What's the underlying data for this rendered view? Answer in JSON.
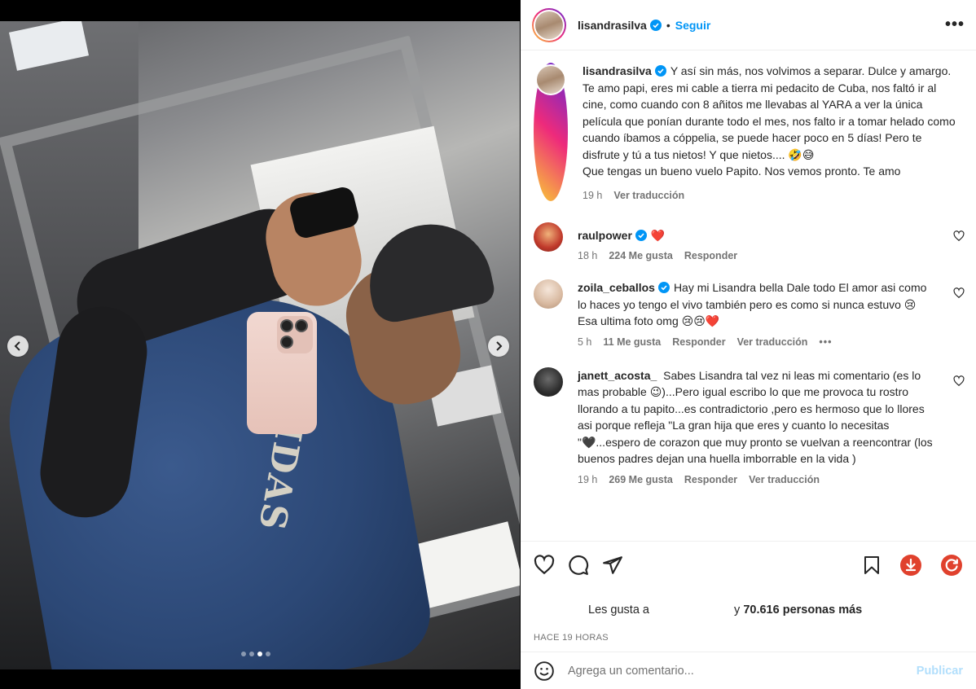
{
  "post": {
    "author": "lisandrasilva",
    "follow_label": "Seguir",
    "more_label": "•••",
    "caption": "Y así sin más, nos volvimos a separar. Dulce y amargo. Te amo papi, eres mi cable a tierra mi pedacito de Cuba, nos faltó ir al cine, como cuando con 8 añitos me llevabas al YARA a ver la única película que ponían durante todo el mes, nos falto ir a tomar helado como cuando íbamos a cóppelia, se puede hacer poco en 5 días! Pero te disfrute y tú a tus nietos! Y que nietos.... 🤣😅",
    "caption_line2": "Que tengas un bueno vuelo Papito. Nos vemos pronto. Te amo",
    "caption_time": "19 h",
    "see_translation": "Ver traducción",
    "carousel_dots": 4,
    "carousel_active": 2
  },
  "comments": [
    {
      "user": "raulpower",
      "verified": true,
      "text": "❤️",
      "time": "18 h",
      "likes": "224 Me gusta",
      "reply": "Responder",
      "translate": ""
    },
    {
      "user": "zoila_ceballos",
      "verified": true,
      "text": "Hay mi Lisandra bella Dale todo El amor asi como lo haces yo tengo el vivo también pero es como si nunca estuvo 😢 Esa ultima foto omg 😢😢❤️",
      "time": "5 h",
      "likes": "11 Me gusta",
      "reply": "Responder",
      "translate": "Ver traducción"
    },
    {
      "user": "janett_acosta_",
      "verified": false,
      "text": "Sabes Lisandra tal vez ni leas mi comentario (es lo mas probable 😉)...Pero igual escribo lo que me provoca tu rostro llorando a tu papito...es contradictorio ,pero es hermoso que lo llores asi porque refleja \"La gran hija que eres y cuanto lo necesitas \"🖤...espero de corazon que muy pronto se vuelvan a reencontrar (los buenos padres dejan una huella imborrable en la vida )",
      "time": "19 h",
      "likes": "269 Me gusta",
      "reply": "Responder",
      "translate": "Ver traducción"
    }
  ],
  "likes_bar": {
    "prefix": "Les gusta a",
    "suffix_pre": "y",
    "count": "70.616 personas más"
  },
  "timestamp": "HACE 19 HORAS",
  "composer": {
    "placeholder": "Agrega un comentario...",
    "publish_label": "Publicar"
  },
  "colors": {
    "link_blue": "#0095f6",
    "publish_disabled": "#b2dffc",
    "muted": "#737373",
    "verified_blue": "#0095f6"
  }
}
